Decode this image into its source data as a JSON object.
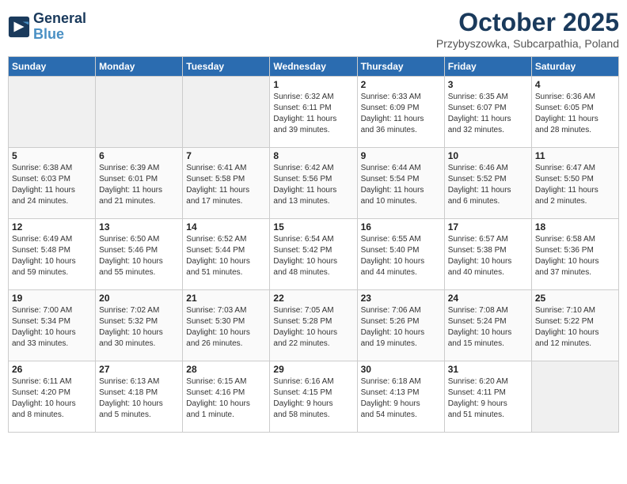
{
  "header": {
    "logo_line1": "General",
    "logo_line2": "Blue",
    "month_title": "October 2025",
    "subtitle": "Przybyszowka, Subcarpathia, Poland"
  },
  "weekdays": [
    "Sunday",
    "Monday",
    "Tuesday",
    "Wednesday",
    "Thursday",
    "Friday",
    "Saturday"
  ],
  "weeks": [
    [
      {
        "day": "",
        "info": ""
      },
      {
        "day": "",
        "info": ""
      },
      {
        "day": "",
        "info": ""
      },
      {
        "day": "1",
        "info": "Sunrise: 6:32 AM\nSunset: 6:11 PM\nDaylight: 11 hours\nand 39 minutes."
      },
      {
        "day": "2",
        "info": "Sunrise: 6:33 AM\nSunset: 6:09 PM\nDaylight: 11 hours\nand 36 minutes."
      },
      {
        "day": "3",
        "info": "Sunrise: 6:35 AM\nSunset: 6:07 PM\nDaylight: 11 hours\nand 32 minutes."
      },
      {
        "day": "4",
        "info": "Sunrise: 6:36 AM\nSunset: 6:05 PM\nDaylight: 11 hours\nand 28 minutes."
      }
    ],
    [
      {
        "day": "5",
        "info": "Sunrise: 6:38 AM\nSunset: 6:03 PM\nDaylight: 11 hours\nand 24 minutes."
      },
      {
        "day": "6",
        "info": "Sunrise: 6:39 AM\nSunset: 6:01 PM\nDaylight: 11 hours\nand 21 minutes."
      },
      {
        "day": "7",
        "info": "Sunrise: 6:41 AM\nSunset: 5:58 PM\nDaylight: 11 hours\nand 17 minutes."
      },
      {
        "day": "8",
        "info": "Sunrise: 6:42 AM\nSunset: 5:56 PM\nDaylight: 11 hours\nand 13 minutes."
      },
      {
        "day": "9",
        "info": "Sunrise: 6:44 AM\nSunset: 5:54 PM\nDaylight: 11 hours\nand 10 minutes."
      },
      {
        "day": "10",
        "info": "Sunrise: 6:46 AM\nSunset: 5:52 PM\nDaylight: 11 hours\nand 6 minutes."
      },
      {
        "day": "11",
        "info": "Sunrise: 6:47 AM\nSunset: 5:50 PM\nDaylight: 11 hours\nand 2 minutes."
      }
    ],
    [
      {
        "day": "12",
        "info": "Sunrise: 6:49 AM\nSunset: 5:48 PM\nDaylight: 10 hours\nand 59 minutes."
      },
      {
        "day": "13",
        "info": "Sunrise: 6:50 AM\nSunset: 5:46 PM\nDaylight: 10 hours\nand 55 minutes."
      },
      {
        "day": "14",
        "info": "Sunrise: 6:52 AM\nSunset: 5:44 PM\nDaylight: 10 hours\nand 51 minutes."
      },
      {
        "day": "15",
        "info": "Sunrise: 6:54 AM\nSunset: 5:42 PM\nDaylight: 10 hours\nand 48 minutes."
      },
      {
        "day": "16",
        "info": "Sunrise: 6:55 AM\nSunset: 5:40 PM\nDaylight: 10 hours\nand 44 minutes."
      },
      {
        "day": "17",
        "info": "Sunrise: 6:57 AM\nSunset: 5:38 PM\nDaylight: 10 hours\nand 40 minutes."
      },
      {
        "day": "18",
        "info": "Sunrise: 6:58 AM\nSunset: 5:36 PM\nDaylight: 10 hours\nand 37 minutes."
      }
    ],
    [
      {
        "day": "19",
        "info": "Sunrise: 7:00 AM\nSunset: 5:34 PM\nDaylight: 10 hours\nand 33 minutes."
      },
      {
        "day": "20",
        "info": "Sunrise: 7:02 AM\nSunset: 5:32 PM\nDaylight: 10 hours\nand 30 minutes."
      },
      {
        "day": "21",
        "info": "Sunrise: 7:03 AM\nSunset: 5:30 PM\nDaylight: 10 hours\nand 26 minutes."
      },
      {
        "day": "22",
        "info": "Sunrise: 7:05 AM\nSunset: 5:28 PM\nDaylight: 10 hours\nand 22 minutes."
      },
      {
        "day": "23",
        "info": "Sunrise: 7:06 AM\nSunset: 5:26 PM\nDaylight: 10 hours\nand 19 minutes."
      },
      {
        "day": "24",
        "info": "Sunrise: 7:08 AM\nSunset: 5:24 PM\nDaylight: 10 hours\nand 15 minutes."
      },
      {
        "day": "25",
        "info": "Sunrise: 7:10 AM\nSunset: 5:22 PM\nDaylight: 10 hours\nand 12 minutes."
      }
    ],
    [
      {
        "day": "26",
        "info": "Sunrise: 6:11 AM\nSunset: 4:20 PM\nDaylight: 10 hours\nand 8 minutes."
      },
      {
        "day": "27",
        "info": "Sunrise: 6:13 AM\nSunset: 4:18 PM\nDaylight: 10 hours\nand 5 minutes."
      },
      {
        "day": "28",
        "info": "Sunrise: 6:15 AM\nSunset: 4:16 PM\nDaylight: 10 hours\nand 1 minute."
      },
      {
        "day": "29",
        "info": "Sunrise: 6:16 AM\nSunset: 4:15 PM\nDaylight: 9 hours\nand 58 minutes."
      },
      {
        "day": "30",
        "info": "Sunrise: 6:18 AM\nSunset: 4:13 PM\nDaylight: 9 hours\nand 54 minutes."
      },
      {
        "day": "31",
        "info": "Sunrise: 6:20 AM\nSunset: 4:11 PM\nDaylight: 9 hours\nand 51 minutes."
      },
      {
        "day": "",
        "info": ""
      }
    ]
  ]
}
